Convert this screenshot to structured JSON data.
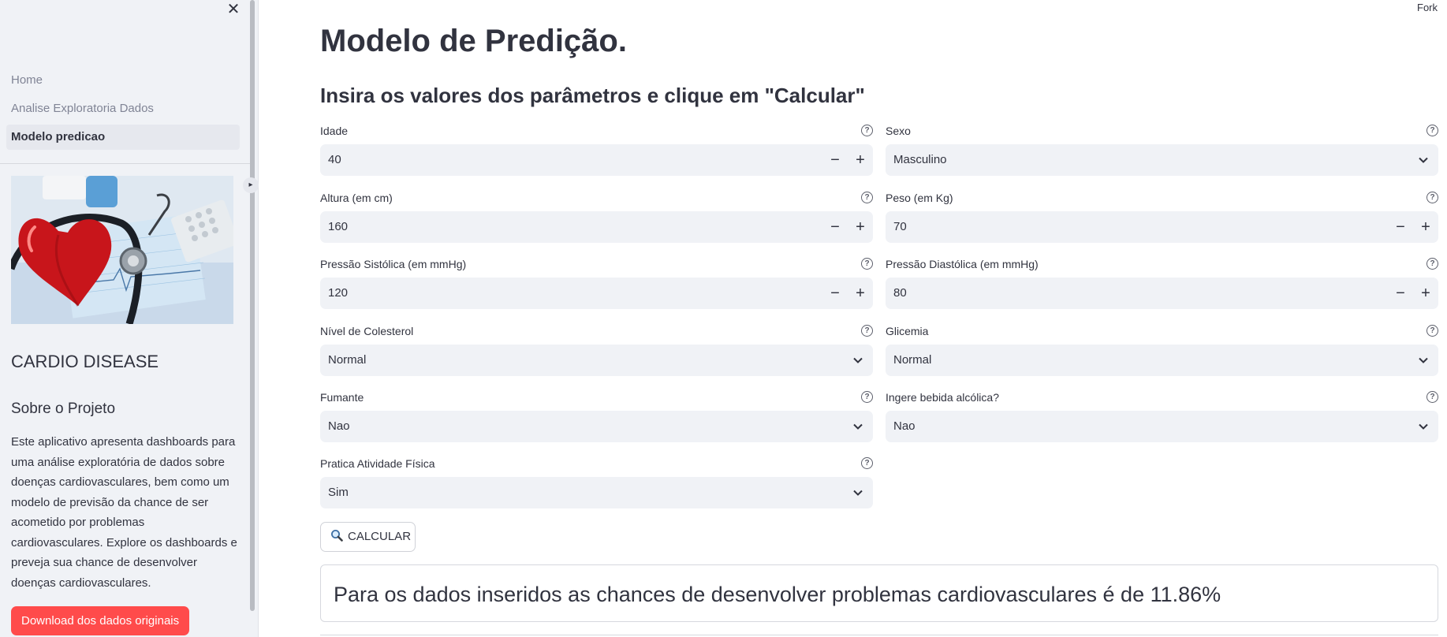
{
  "sidebar": {
    "nav": [
      {
        "label": "Home",
        "active": false
      },
      {
        "label": "Analise Exploratoria Dados",
        "active": false
      },
      {
        "label": "Modelo predicao",
        "active": true
      }
    ],
    "brand_title": "CARDIO DISEASE",
    "about_title": "Sobre o Projeto",
    "about_text": "Este aplicativo apresenta dashboards para uma análise exploratória de dados sobre doenças cardiovasculares, bem como um modelo de previsão da chance de ser acometido por problemas cardiovasculares. Explore os dashboards e preveja sua chance de desenvolver doenças cardiovasculares.",
    "download_label": "Download dos dados originais",
    "close_icon": "close-icon"
  },
  "header": {
    "fork_label": "Fork"
  },
  "main": {
    "title": "Modelo de Predição.",
    "subtitle": "Insira os valores dos parâmetros e clique em \"Calcular\"",
    "fields": {
      "idade": {
        "label": "Idade",
        "value": "40"
      },
      "sexo": {
        "label": "Sexo",
        "value": "Masculino"
      },
      "altura": {
        "label": "Altura (em cm)",
        "value": "160"
      },
      "peso": {
        "label": "Peso (em Kg)",
        "value": "70"
      },
      "sistolica": {
        "label": "Pressão Sistólica (em mmHg)",
        "value": "120"
      },
      "diastolica": {
        "label": "Pressão Diastólica (em mmHg)",
        "value": "80"
      },
      "colesterol": {
        "label": "Nível de Colesterol",
        "value": "Normal"
      },
      "glicemia": {
        "label": "Glicemia",
        "value": "Normal"
      },
      "fumante": {
        "label": "Fumante",
        "value": "Nao"
      },
      "alcool": {
        "label": "Ingere bebida alcólica?",
        "value": "Nao"
      },
      "atividade": {
        "label": "Pratica Atividade Física",
        "value": "Sim"
      }
    },
    "stepper_minus": "−",
    "stepper_plus": "+",
    "help_glyph": "?",
    "calc_label": "CALCULAR",
    "result_text": "Para os dados inseridos as chances de desenvolver problemas cardiovasculares é de 11.86%"
  },
  "colors": {
    "accent": "#ff4b4b",
    "sidebar_bg": "#f0f2f6",
    "input_bg": "#f0f2f6",
    "text": "#31333f"
  }
}
